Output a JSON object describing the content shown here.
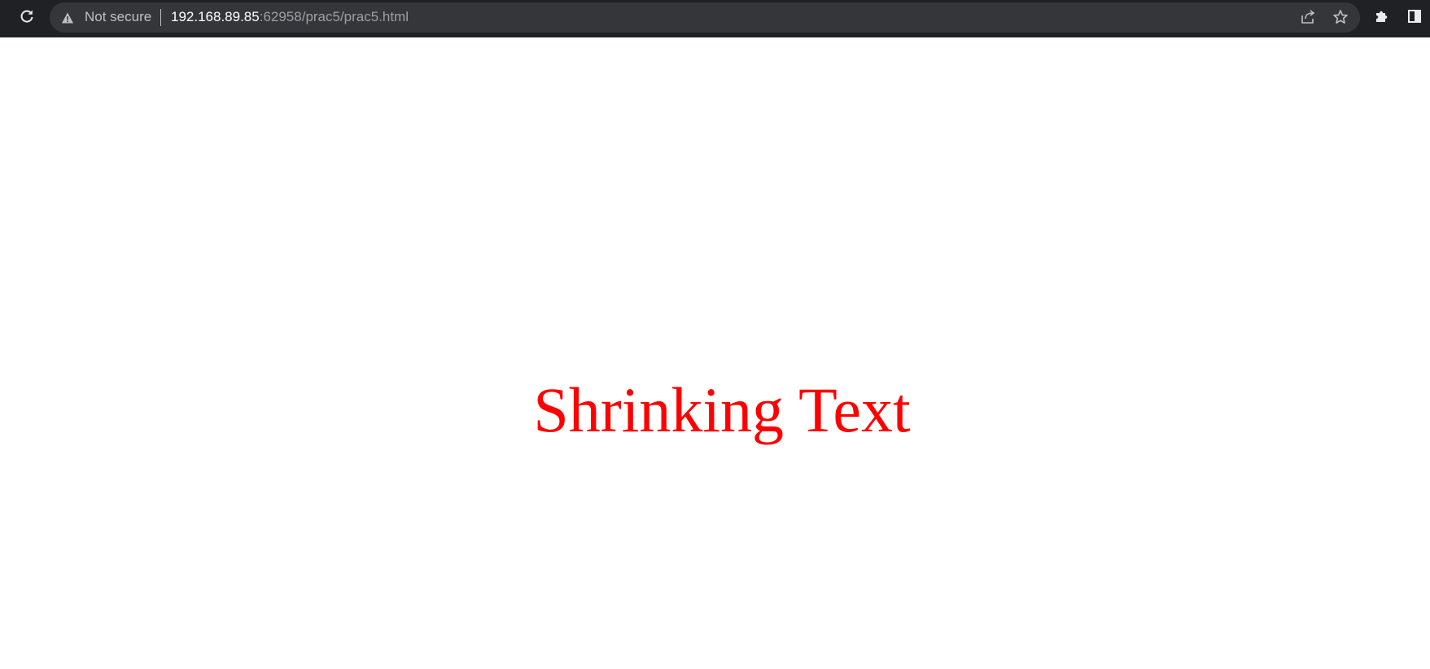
{
  "browser": {
    "security_label": "Not secure",
    "url_host": "192.168.89.85",
    "url_rest": ":62958/prac5/prac5.html",
    "icons": {
      "back": "back-arrow-icon",
      "reload": "reload-icon",
      "warning": "warning-icon",
      "share": "share-icon",
      "bookmark": "star-icon",
      "extensions": "puzzle-icon",
      "side_panel": "side-panel-icon"
    },
    "colors": {
      "toolbar": "#202124",
      "omnibox": "#35363a"
    }
  },
  "page": {
    "heading": "Shrinking Text",
    "heading_color": "#ff0000"
  }
}
